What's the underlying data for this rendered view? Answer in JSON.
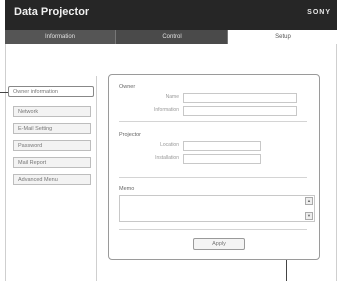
{
  "header": {
    "title": "Data Projector",
    "brand": "SONY"
  },
  "tabs": [
    {
      "label": "Information"
    },
    {
      "label": "Control"
    },
    {
      "label": "Setup"
    }
  ],
  "sidebar": {
    "items": [
      {
        "label": "Owner information"
      },
      {
        "label": "Network"
      },
      {
        "label": "E-Mail Setting"
      },
      {
        "label": "Password"
      },
      {
        "label": "Mail Report"
      },
      {
        "label": "Advanced Menu"
      }
    ]
  },
  "panel": {
    "owner_title": "Owner",
    "owner_name_label": "Name",
    "owner_info_label": "Information",
    "projector_title": "Projector",
    "projector_location_label": "Location",
    "projector_installation_label": "Installation",
    "memo_title": "Memo",
    "apply_label": "Apply"
  },
  "colors": {
    "header_bg": "#262626",
    "tab_bg": "#555555"
  }
}
